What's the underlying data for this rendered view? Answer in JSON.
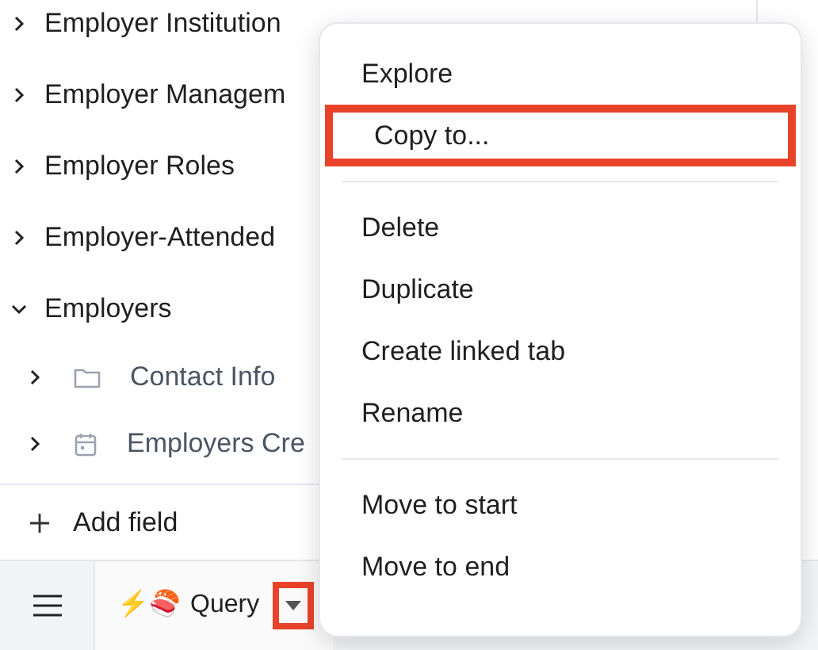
{
  "tree": [
    {
      "label": "Employer Institution",
      "expanded": false
    },
    {
      "label": "Employer Managem",
      "expanded": false
    },
    {
      "label": "Employer Roles",
      "expanded": false
    },
    {
      "label": "Employer-Attended",
      "expanded": false
    },
    {
      "label": "Employers",
      "expanded": true,
      "children": [
        {
          "label": "Contact Info",
          "kind": "folder",
          "expanded": false
        },
        {
          "label": "Employers Cre",
          "kind": "date",
          "expanded": false
        }
      ]
    }
  ],
  "add_field": "Add field",
  "bottom_bar": {
    "tab": {
      "emoji": "⚡🍣",
      "label": "Query"
    }
  },
  "context_menu": {
    "groups": [
      [
        {
          "label": "Explore",
          "highlighted": false
        },
        {
          "label": "Copy to...",
          "highlighted": true
        }
      ],
      [
        {
          "label": "Delete",
          "highlighted": false
        },
        {
          "label": "Duplicate",
          "highlighted": false
        },
        {
          "label": "Create linked tab",
          "highlighted": false
        },
        {
          "label": "Rename",
          "highlighted": false
        }
      ],
      [
        {
          "label": "Move to start",
          "highlighted": false
        },
        {
          "label": "Move to end",
          "highlighted": false
        }
      ]
    ]
  },
  "annotations": {
    "caret_highlighted": true
  }
}
